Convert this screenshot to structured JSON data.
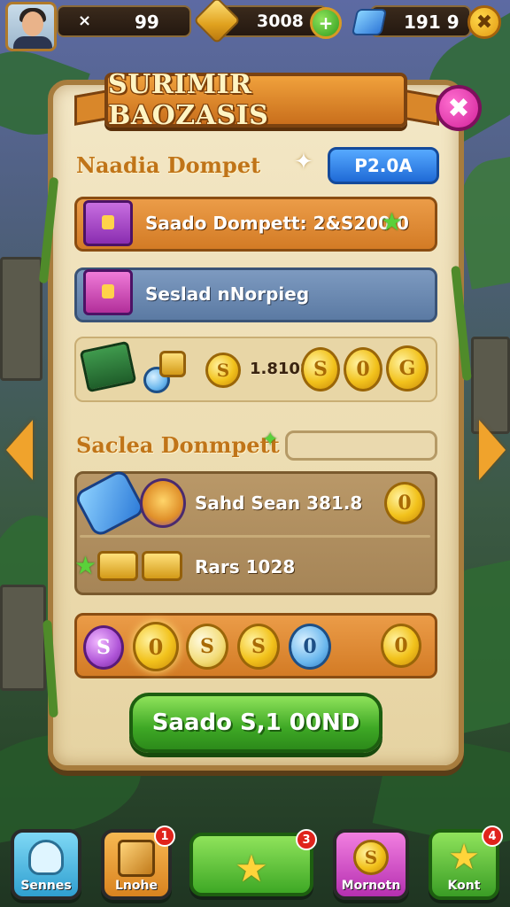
{
  "hud": {
    "stat_1": "99",
    "stat_1_prefix": "×",
    "stat_2": "3008",
    "stat_3": "191 9",
    "close_icon": "✖"
  },
  "panel": {
    "title": "SURIMIR BAOZASIS",
    "close_icon": "✖",
    "section_1_title": "Naadia Dompet",
    "section_1_button": "P2.0A",
    "row_1_text": "Saado Dompett: 2&S200 0",
    "row_2_text": "Seslad nNorpieg",
    "row_3_value": "1.8108",
    "section_2_title": "Saclea Donmpett",
    "row_4_text": "Sahd  Sean 381.8",
    "row_5_text": "Rars 1028",
    "cta_label": "Saado S,1 00ND"
  },
  "nav": {
    "items": [
      {
        "label": "Sennes",
        "badge": ""
      },
      {
        "label": "Lnohe",
        "badge": "1"
      },
      {
        "label": "",
        "badge": "3"
      },
      {
        "label": "Mornotn",
        "badge": ""
      },
      {
        "label": "Kont",
        "badge": "4"
      }
    ]
  },
  "colors": {
    "accent_orange": "#d37b25",
    "cta_green": "#3ea825",
    "panel_parchment": "#ecdcb0",
    "close_magenta": "#d2219a"
  }
}
